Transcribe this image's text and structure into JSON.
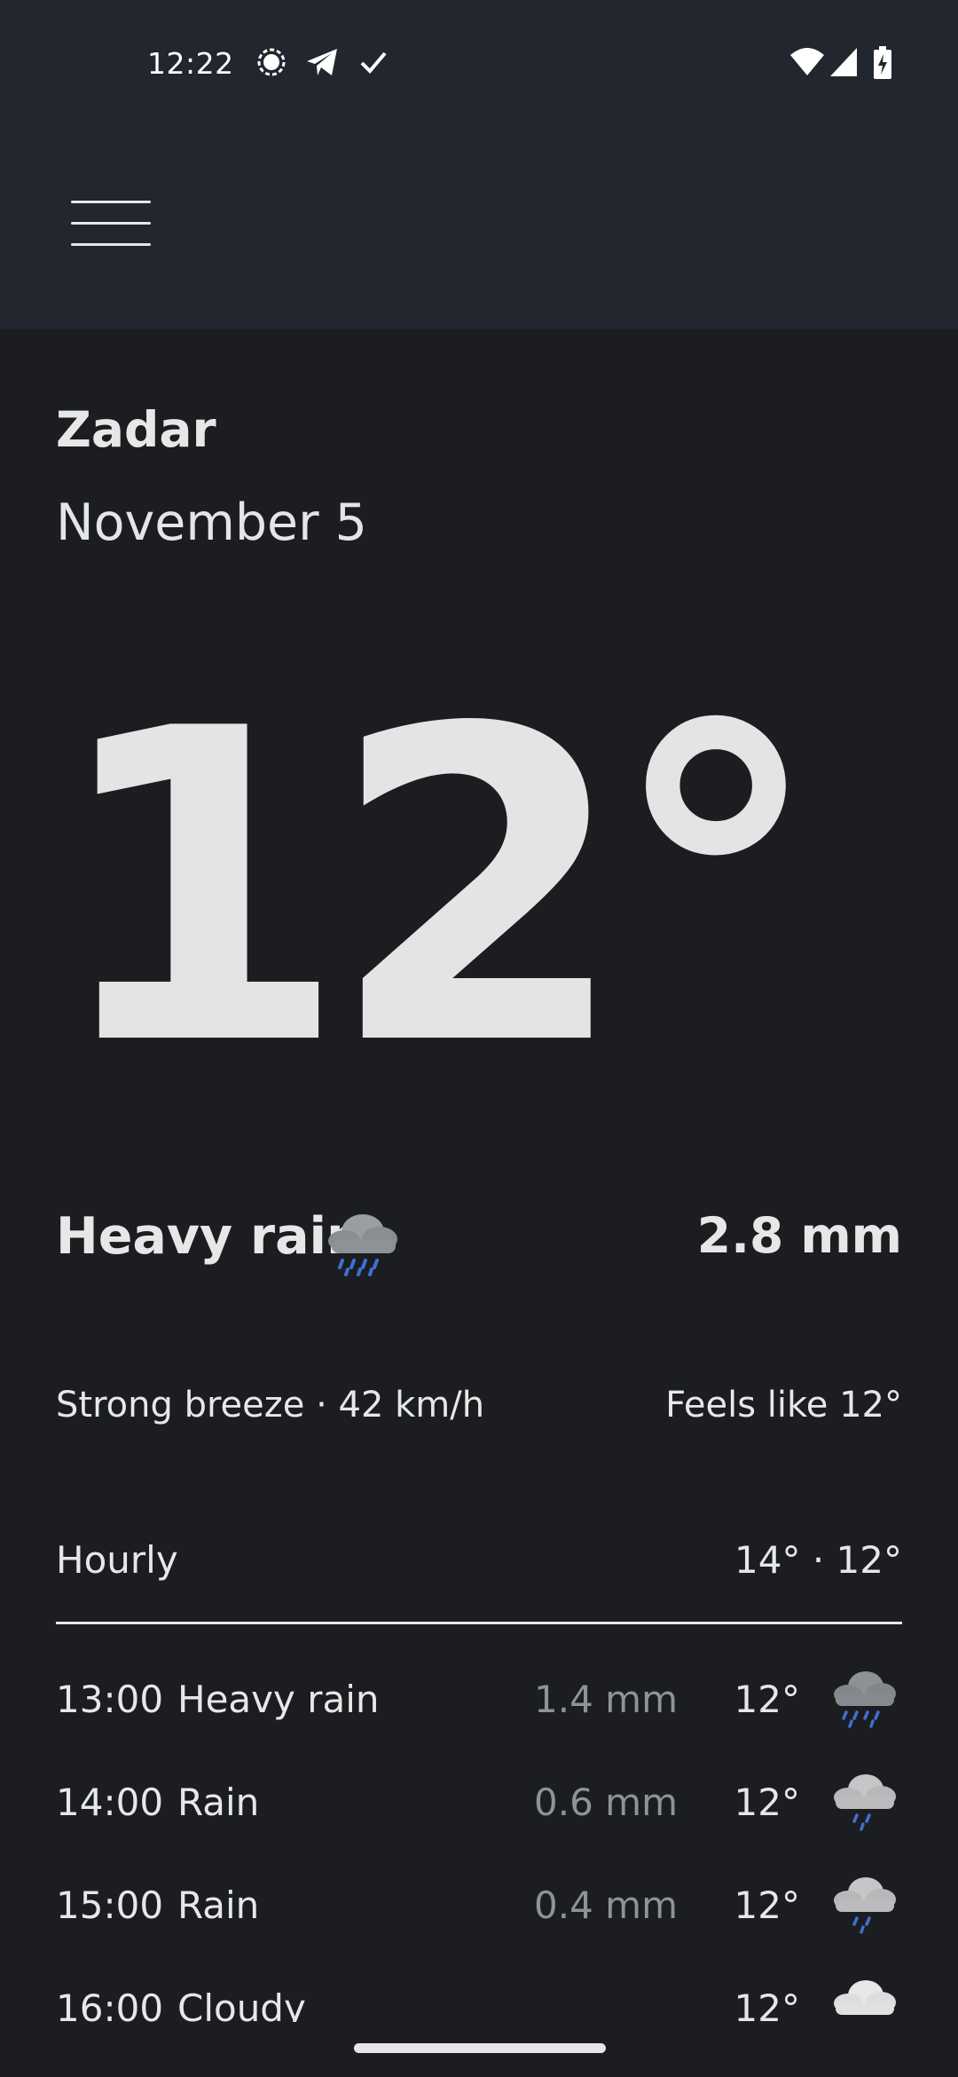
{
  "status_bar": {
    "time": "12:22",
    "icons": [
      "signal-messenger-icon",
      "telegram-icon",
      "check-icon",
      "wifi-icon",
      "cell-signal-icon",
      "battery-charging-icon"
    ]
  },
  "header": {
    "menu_icon": "hamburger-menu-icon"
  },
  "location": {
    "city": "Zadar",
    "date": "November 5"
  },
  "current": {
    "temperature": "12°",
    "condition": "Heavy rain",
    "condition_icon": "heavy-rain-cloud-icon",
    "precipitation": "2.8 mm",
    "wind": "Strong breeze · 42 km/h",
    "feels_like": "Feels like 12°"
  },
  "hourly": {
    "title": "Hourly",
    "range": "14° · 12°",
    "rows": [
      {
        "time": "13:00",
        "desc": "Heavy rain",
        "precip": "1.4 mm",
        "temp": "12°",
        "icon": "heavy-rain-icon"
      },
      {
        "time": "14:00",
        "desc": "Rain",
        "precip": "0.6 mm",
        "temp": "12°",
        "icon": "rain-icon"
      },
      {
        "time": "15:00",
        "desc": "Rain",
        "precip": "0.4 mm",
        "temp": "12°",
        "icon": "rain-icon"
      },
      {
        "time": "16:00",
        "desc": "Cloudy",
        "precip": "",
        "temp": "12°",
        "icon": "cloudy-icon"
      }
    ]
  },
  "colors": {
    "background": "#1b1d20",
    "topbar": "#22262f",
    "text": "#e6e8e8",
    "muted": "#8f9396",
    "rain_drop": "#3f6fd0"
  }
}
